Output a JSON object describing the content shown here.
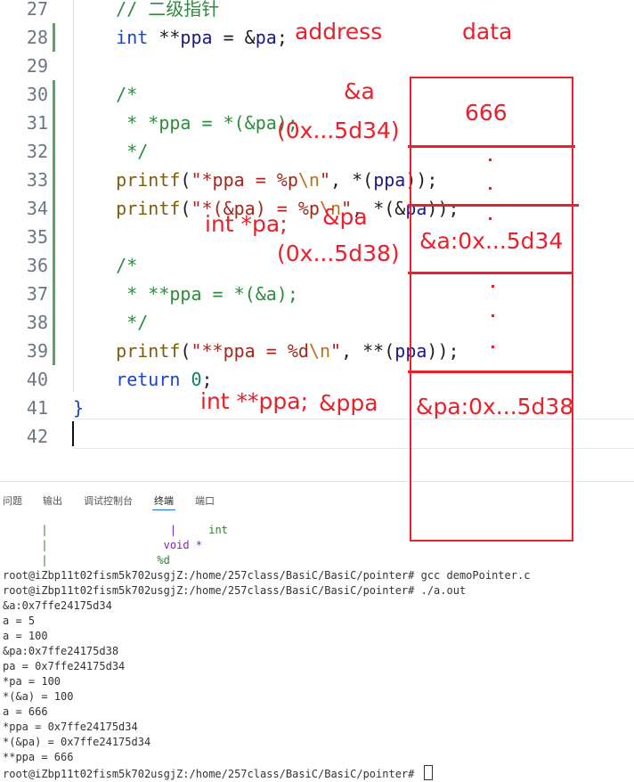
{
  "editor": {
    "lines": [
      {
        "no": "27",
        "tokens": [
          {
            "t": "    // 二级指针",
            "c": "cmt"
          }
        ]
      },
      {
        "no": "28",
        "tokens": [
          {
            "t": "    ",
            "c": ""
          },
          {
            "t": "int",
            "c": "kw"
          },
          {
            "t": " **",
            "c": ""
          },
          {
            "t": "ppa",
            "c": "var"
          },
          {
            "t": " = &",
            "c": ""
          },
          {
            "t": "pa",
            "c": "var"
          },
          {
            "t": ";",
            "c": ""
          }
        ]
      },
      {
        "no": "29",
        "tokens": []
      },
      {
        "no": "30",
        "tokens": [
          {
            "t": "    /*",
            "c": "cmt"
          }
        ]
      },
      {
        "no": "31",
        "tokens": [
          {
            "t": "     * *ppa = *(&pa);",
            "c": "cmt"
          }
        ]
      },
      {
        "no": "32",
        "tokens": [
          {
            "t": "     */",
            "c": "cmt"
          }
        ]
      },
      {
        "no": "33",
        "tokens": [
          {
            "t": "    ",
            "c": ""
          },
          {
            "t": "printf",
            "c": "fn"
          },
          {
            "t": "(",
            "c": ""
          },
          {
            "t": "\"*ppa = %p",
            "c": "str"
          },
          {
            "t": "\\n",
            "c": "esc"
          },
          {
            "t": "\"",
            "c": "str"
          },
          {
            "t": ", *(",
            "c": ""
          },
          {
            "t": "ppa",
            "c": "var"
          },
          {
            "t": "));",
            "c": ""
          }
        ]
      },
      {
        "no": "34",
        "tokens": [
          {
            "t": "    ",
            "c": ""
          },
          {
            "t": "printf",
            "c": "fn"
          },
          {
            "t": "(",
            "c": ""
          },
          {
            "t": "\"*(&pa) = %p",
            "c": "str"
          },
          {
            "t": "\\n",
            "c": "esc"
          },
          {
            "t": "\"",
            "c": "str"
          },
          {
            "t": ", *(&",
            "c": ""
          },
          {
            "t": "pa",
            "c": "var"
          },
          {
            "t": "));",
            "c": ""
          }
        ]
      },
      {
        "no": "35",
        "tokens": []
      },
      {
        "no": "36",
        "tokens": [
          {
            "t": "    /*",
            "c": "cmt"
          }
        ]
      },
      {
        "no": "37",
        "tokens": [
          {
            "t": "     * **ppa = *(&a);",
            "c": "cmt"
          }
        ]
      },
      {
        "no": "38",
        "tokens": [
          {
            "t": "     */",
            "c": "cmt"
          }
        ]
      },
      {
        "no": "39",
        "tokens": [
          {
            "t": "    ",
            "c": ""
          },
          {
            "t": "printf",
            "c": "fn"
          },
          {
            "t": "(",
            "c": ""
          },
          {
            "t": "\"**ppa = %d",
            "c": "str"
          },
          {
            "t": "\\n",
            "c": "esc"
          },
          {
            "t": "\"",
            "c": "str"
          },
          {
            "t": ", **(",
            "c": ""
          },
          {
            "t": "ppa",
            "c": "var"
          },
          {
            "t": "));",
            "c": ""
          }
        ]
      },
      {
        "no": "40",
        "tokens": [
          {
            "t": "    ",
            "c": ""
          },
          {
            "t": "return",
            "c": "kw"
          },
          {
            "t": " ",
            "c": ""
          },
          {
            "t": "0",
            "c": "num"
          },
          {
            "t": ";",
            "c": ""
          }
        ]
      },
      {
        "no": "41",
        "tokens": [
          {
            "t": "}",
            "c": "kw"
          }
        ]
      },
      {
        "no": "42",
        "tokens": []
      }
    ]
  },
  "annotations": {
    "address_header": "address",
    "data_header": "data",
    "a_label": "&a",
    "a_addr": "(0x...5d34)",
    "a_value": "666",
    "pa_decl": "int *pa;",
    "pa_label": "&pa",
    "pa_addr": "(0x...5d38)",
    "pa_value": "&a:0x...5d34",
    "ppa_decl": "int **ppa;",
    "ppa_label": "&ppa",
    "ppa_value": "&pa:0x...5d38"
  },
  "panel": {
    "tabs": [
      "问题",
      "输出",
      "调试控制台",
      "终端",
      "端口"
    ],
    "active_tab": "终端",
    "terminal_head": {
      "int_hint": "int",
      "void_hint": "void *",
      "fmt_hint": "%d"
    },
    "terminal_lines": [
      "root@iZbp11t02fism5k702usgjZ:/home/257class/BasiC/BasiC/pointer# gcc demoPointer.c",
      "root@iZbp11t02fism5k702usgjZ:/home/257class/BasiC/BasiC/pointer# ./a.out",
      "&a:0x7ffe24175d34",
      "a = 5",
      "a = 100",
      "&pa:0x7ffe24175d38",
      "pa = 0x7ffe24175d34",
      "*pa = 100",
      "*(&a) = 100",
      "a = 666",
      "*ppa = 0x7ffe24175d34",
      "*(&pa) = 0x7ffe24175d34",
      "**ppa = 666",
      "root@iZbp11t02fism5k702usgjZ:/home/257class/BasiC/BasiC/pointer# "
    ]
  }
}
